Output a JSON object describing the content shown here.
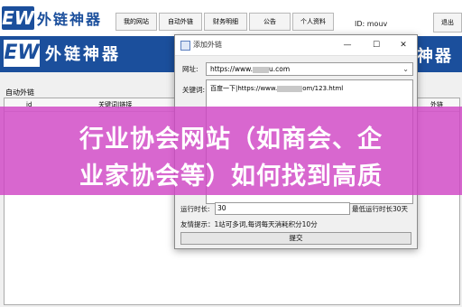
{
  "app": {
    "logo_mark": "EW",
    "logo_text": "外链神器",
    "tabs": [
      "我的网站",
      "自动外链",
      "财务明细",
      "公告",
      "个人资料"
    ],
    "id_label": "ID: mouv",
    "exit_label": "退出",
    "band_right_text": "神器"
  },
  "main": {
    "section_label": "自动外链",
    "columns": {
      "id": "id",
      "keyword": "关键词|链接",
      "right": "外链"
    }
  },
  "dialog": {
    "title": "添加外链",
    "minimize": "—",
    "maximize": "☐",
    "close": "✕",
    "url_label": "网址:",
    "url_value_pre": "https://www.",
    "url_value_post": "u.com",
    "keyword_label": "关键词:",
    "keyword_value_pre": "百度一下|https://www.",
    "keyword_value_post": "om/123.html",
    "run_time_label": "运行时长:",
    "run_time_value": "30",
    "min_run_time": "最低运行时长30天",
    "tip": "友情提示：1站可多词,每词每天消耗积分10分",
    "submit": "提交"
  },
  "overlay": {
    "line1": "行业协会网站（如商会、企",
    "line2": "业家协会等）如何找到高质"
  },
  "colors": {
    "brand_blue": "#1b4f9c",
    "overlay_pink": "#d046c4"
  }
}
